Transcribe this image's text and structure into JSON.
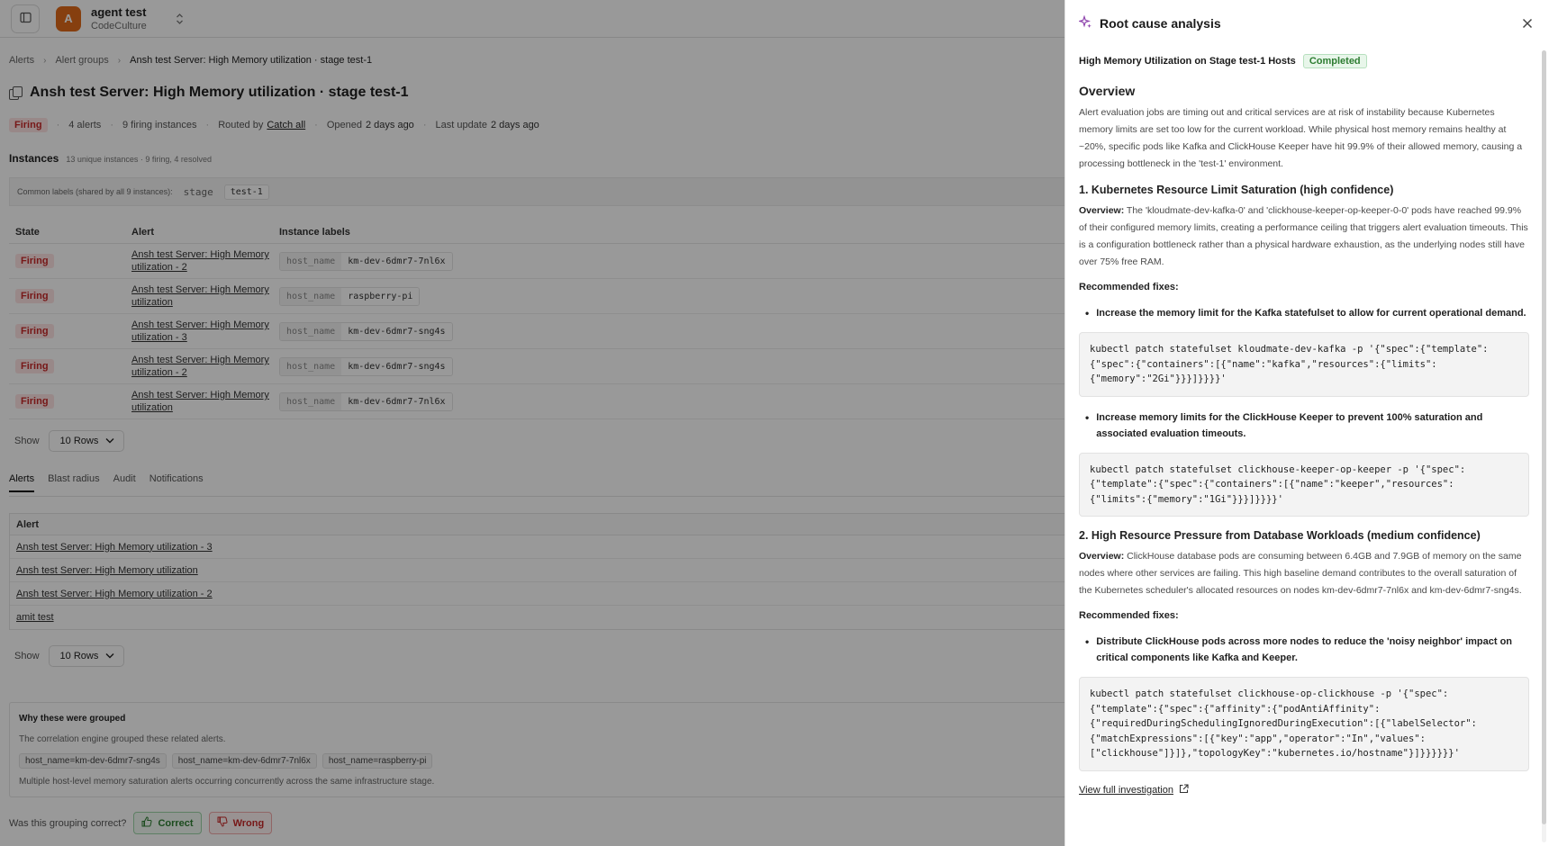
{
  "topbar": {
    "org_avatar_letter": "A",
    "org_name": "agent test",
    "org_subtitle": "CodeCulture"
  },
  "breadcrumb": {
    "items": [
      "Alerts",
      "Alert groups",
      "Ansh test Server: High Memory utilization · stage test-1"
    ]
  },
  "page": {
    "title": "Ansh test Server: High Memory utilization · stage test-1",
    "status": "Firing",
    "alerts_count": "4 alerts",
    "firing_instances": "9 firing instances",
    "routed_by_label": "Routed by",
    "routed_by_value": "Catch all",
    "opened_label": "Opened",
    "opened_value": "2 days ago",
    "last_update_label": "Last update",
    "last_update_value": "2 days ago"
  },
  "instances": {
    "title": "Instances",
    "subtitle": "13 unique instances · 9 firing, 4 resolved",
    "common_labels_text": "Common labels (shared by all 9 instances):",
    "common_label_key": "stage",
    "common_label_value": "test-1",
    "columns": [
      "State",
      "Alert",
      "Instance labels"
    ],
    "rows": [
      {
        "state": "Firing",
        "alert_line1": "Ansh test Server: High Memory",
        "alert_line2": "utilization - 2",
        "label_key": "host_name",
        "label_value": "km-dev-6dmr7-7nl6x"
      },
      {
        "state": "Firing",
        "alert_line1": "Ansh test Server: High Memory",
        "alert_line2": "utilization",
        "label_key": "host_name",
        "label_value": "raspberry-pi"
      },
      {
        "state": "Firing",
        "alert_line1": "Ansh test Server: High Memory",
        "alert_line2": "utilization - 3",
        "label_key": "host_name",
        "label_value": "km-dev-6dmr7-sng4s"
      },
      {
        "state": "Firing",
        "alert_line1": "Ansh test Server: High Memory",
        "alert_line2": "utilization - 2",
        "label_key": "host_name",
        "label_value": "km-dev-6dmr7-sng4s"
      },
      {
        "state": "Firing",
        "alert_line1": "Ansh test Server: High Memory",
        "alert_line2": "utilization",
        "label_key": "host_name",
        "label_value": "km-dev-6dmr7-7nl6x"
      }
    ],
    "show_label": "Show",
    "rows_select": "10 Rows"
  },
  "tabs": [
    "Alerts",
    "Blast radius",
    "Audit",
    "Notifications"
  ],
  "alerts_table": {
    "column": "Alert",
    "rows": [
      "Ansh test Server: High Memory utilization - 3",
      "Ansh test Server: High Memory utilization",
      "Ansh test Server: High Memory utilization - 2",
      "amit test"
    ],
    "show_label": "Show",
    "rows_select": "10 Rows"
  },
  "why_grouped": {
    "title": "Why these were grouped",
    "description": "The correlation engine grouped these related alerts.",
    "chips": [
      "host_name=km-dev-6dmr7-sng4s",
      "host_name=km-dev-6dmr7-7nl6x",
      "host_name=raspberry-pi"
    ],
    "footer": "Multiple host-level memory saturation alerts occurring concurrently across the same infrastructure stage."
  },
  "feedback": {
    "question": "Was this grouping correct?",
    "correct_label": "Correct",
    "wrong_label": "Wrong"
  },
  "rca": {
    "title": "Root cause analysis",
    "summary_title": "High Memory Utilization on Stage test-1 Hosts",
    "status": "Completed",
    "overview_heading": "Overview",
    "overview_text": "Alert evaluation jobs are timing out and critical services are at risk of instability because Kubernetes memory limits are set too low for the current workload. While physical host memory remains healthy at ~20%, specific pods like Kafka and ClickHouse Keeper have hit 99.9% of their allowed memory, causing a processing bottleneck in the 'test-1' environment.",
    "finding1_heading": "1. Kubernetes Resource Limit Saturation (high confidence)",
    "finding1_overview_label": "Overview:",
    "finding1_overview_text": " The 'kloudmate-dev-kafka-0' and 'clickhouse-keeper-op-keeper-0-0' pods have reached 99.9% of their configured memory limits, creating a performance ceiling that triggers alert evaluation timeouts. This is a configuration bottleneck rather than a physical hardware exhaustion, as the underlying nodes still have over 75% free RAM.",
    "finding1_rec_label": "Recommended fixes:",
    "finding1_fix1": "Increase the memory limit for the Kafka statefulset to allow for current operational demand.",
    "finding1_code1": "kubectl patch statefulset kloudmate-dev-kafka -p '{\"spec\":{\"template\":\n{\"spec\":{\"containers\":[{\"name\":\"kafka\",\"resources\":{\"limits\":\n{\"memory\":\"2Gi\"}}}]}}}}'",
    "finding1_fix2": "Increase memory limits for the ClickHouse Keeper to prevent 100% saturation and associated evaluation timeouts.",
    "finding1_code2": "kubectl patch statefulset clickhouse-keeper-op-keeper -p '{\"spec\":\n{\"template\":{\"spec\":{\"containers\":[{\"name\":\"keeper\",\"resources\":\n{\"limits\":{\"memory\":\"1Gi\"}}}]}}}}'",
    "finding2_heading": "2. High Resource Pressure from Database Workloads (medium confidence)",
    "finding2_overview_label": "Overview:",
    "finding2_overview_text": " ClickHouse database pods are consuming between 6.4GB and 7.9GB of memory on the same nodes where other services are failing. This high baseline demand contributes to the overall saturation of the Kubernetes scheduler's allocated resources on nodes km-dev-6dmr7-7nl6x and km-dev-6dmr7-sng4s.",
    "finding2_rec_label": "Recommended fixes:",
    "finding2_fix1": "Distribute ClickHouse pods across more nodes to reduce the 'noisy neighbor' impact on critical components like Kafka and Keeper.",
    "finding2_code1": "kubectl patch statefulset clickhouse-op-clickhouse -p '{\"spec\":\n{\"template\":{\"spec\":{\"affinity\":{\"podAntiAffinity\":\n{\"requiredDuringSchedulingIgnoredDuringExecution\":[{\"labelSelector\":\n{\"matchExpressions\":[{\"key\":\"app\",\"operator\":\"In\",\"values\":\n[\"clickhouse\"]}]},\"topologyKey\":\"kubernetes.io/hostname\"}]}}}}}}'",
    "view_full": "View full investigation"
  },
  "colors": {
    "firing_bg": "#fde3e3",
    "firing_text": "#c62828",
    "completed_text": "#2e7d32",
    "sparkle": "#8e44ad",
    "org_avatar": "#e06a1a"
  }
}
